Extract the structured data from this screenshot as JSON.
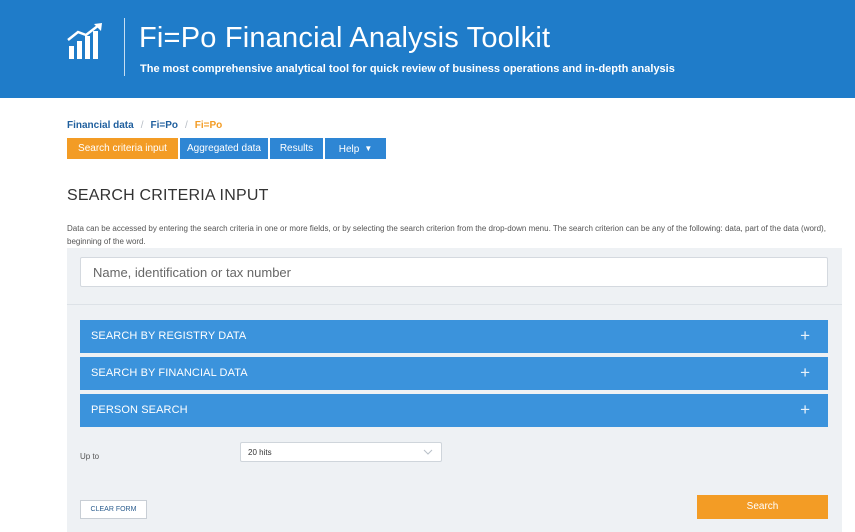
{
  "header": {
    "logo_icon": "bar-chart-growth-icon",
    "title": "Fi=Po Financial Analysis Toolkit",
    "subtitle": "The most comprehensive analytical tool for quick review of business operations and in-depth analysis"
  },
  "breadcrumb": {
    "items": [
      "Financial data",
      "Fi=Po",
      "Fi=Po"
    ],
    "separator": "/"
  },
  "tabs": [
    {
      "label": "Search criteria input",
      "active": true
    },
    {
      "label": "Aggregated data",
      "active": false
    },
    {
      "label": "Results",
      "active": false
    },
    {
      "label": "Help",
      "active": false,
      "has_dropdown": true
    }
  ],
  "section": {
    "title": "SEARCH CRITERIA INPUT",
    "intro": "Data can be accessed by entering the search criteria in one or more fields, or by selecting the search criterion from the drop-down menu. The search criterion can be any of the following: data, part of the data (word), beginning of the word."
  },
  "search": {
    "placeholder": "Name, identification or tax number",
    "value": ""
  },
  "accordions": [
    {
      "label": "SEARCH BY REGISTRY DATA",
      "icon": "plus-icon"
    },
    {
      "label": "SEARCH BY FINANCIAL DATA",
      "icon": "plus-icon"
    },
    {
      "label": "PERSON SEARCH",
      "icon": "plus-icon"
    }
  ],
  "limit": {
    "label": "Up to",
    "selected": "20 hits"
  },
  "actions": {
    "clear_label": "CLEAR FORM",
    "search_label": "Search"
  },
  "colors": {
    "banner": "#1f7cc9",
    "accent_orange": "#f39c25",
    "tab_blue": "#2e86d4",
    "accordion_blue": "#3b93dc",
    "panel_bg": "#eef1f4"
  }
}
